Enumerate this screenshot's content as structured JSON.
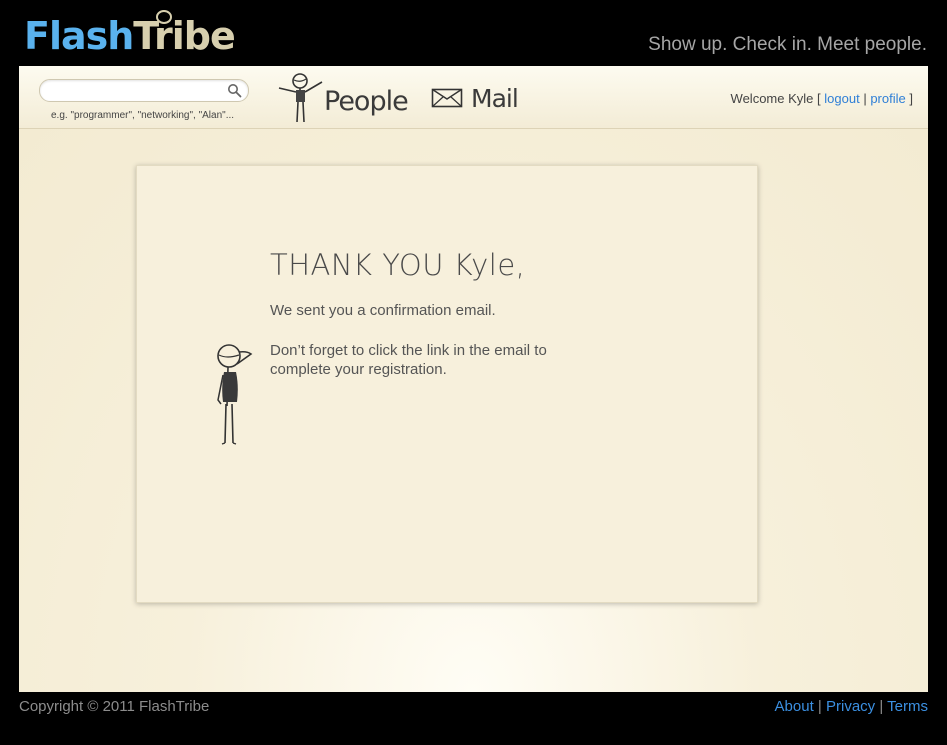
{
  "brand": {
    "part1": "Flash",
    "part2": "Tribe",
    "tagline": "Show up. Check in. Meet people."
  },
  "search": {
    "value": "",
    "placeholder": "",
    "hint": "e.g. \"programmer\", \"networking\", \"Alan\"..."
  },
  "nav": {
    "people": "People",
    "mail": "Mail"
  },
  "user": {
    "welcome": "Welcome Kyle",
    "open_bracket": "[",
    "logout": "logout",
    "separator": "|",
    "profile": "profile",
    "close_bracket": "]"
  },
  "main": {
    "title": "THANK YOU Kyle,",
    "message1": "We sent you a confirmation email.",
    "message2": "Don’t forget to click the link in the email to complete your registration."
  },
  "footer": {
    "copyright": "Copyright © 2011 FlashTribe",
    "links": [
      "About",
      "Privacy",
      "Terms"
    ],
    "sep": "|"
  },
  "icons": {
    "search": "search-icon",
    "people": "stick-figure-icon",
    "mail": "envelope-icon",
    "illustration": "stick-figure-illustration"
  },
  "colors": {
    "link": "#2f7fd6",
    "brand_blue": "#5ab2ee",
    "brand_tan": "#d7cfae",
    "background": "#f3ebd2"
  }
}
